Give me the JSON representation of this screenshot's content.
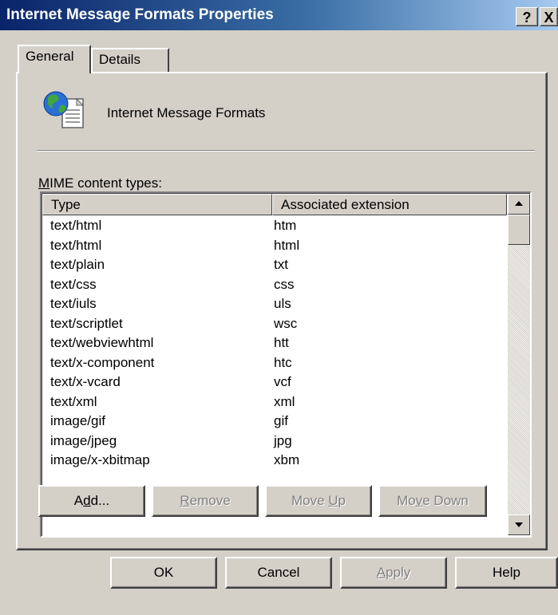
{
  "window": {
    "title": "Internet Message Formats Properties",
    "help_glyph": "?",
    "close_glyph": "X"
  },
  "tabs": [
    {
      "label": "General",
      "active": true
    },
    {
      "label": "Details",
      "active": false
    }
  ],
  "general": {
    "icon": "globe-document-icon",
    "name": "Internet Message Formats",
    "list_label_prefix": "M",
    "list_label_rest": "IME content types:"
  },
  "mime_list": {
    "columns": [
      "Type",
      "Associated extension"
    ],
    "rows": [
      {
        "type": "text/html",
        "ext": "htm"
      },
      {
        "type": "text/html",
        "ext": "html"
      },
      {
        "type": "text/plain",
        "ext": "txt"
      },
      {
        "type": "text/css",
        "ext": "css"
      },
      {
        "type": "text/iuls",
        "ext": "uls"
      },
      {
        "type": "text/scriptlet",
        "ext": "wsc"
      },
      {
        "type": "text/webviewhtml",
        "ext": "htt"
      },
      {
        "type": "text/x-component",
        "ext": "htc"
      },
      {
        "type": "text/x-vcard",
        "ext": "vcf"
      },
      {
        "type": "text/xml",
        "ext": "xml"
      },
      {
        "type": "image/gif",
        "ext": "gif"
      },
      {
        "type": "image/jpeg",
        "ext": "jpg"
      },
      {
        "type": "image/x-xbitmap",
        "ext": "xbm"
      }
    ]
  },
  "list_buttons": {
    "add": {
      "pre": "A",
      "u": "d",
      "post": "d..."
    },
    "remove": {
      "pre": "",
      "u": "R",
      "post": "emove"
    },
    "move_up": {
      "pre": "Move ",
      "u": "U",
      "post": "p"
    },
    "move_down": {
      "pre": "Mo",
      "u": "v",
      "post": "e Down"
    }
  },
  "dialog_buttons": {
    "ok": "OK",
    "cancel": "Cancel",
    "apply": {
      "pre": "",
      "u": "A",
      "post": "pply"
    },
    "help": "Help"
  },
  "colors": {
    "title_bar_start": "#0a246a",
    "title_bar_end": "#a6caf0",
    "face": "#d4d0c8",
    "disabled_text": "#808080"
  }
}
